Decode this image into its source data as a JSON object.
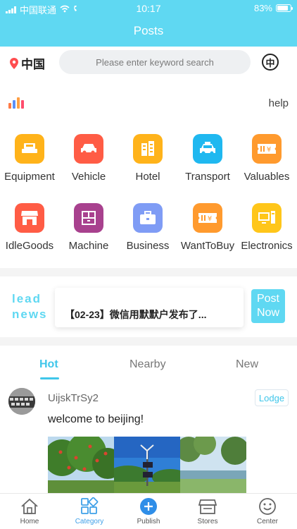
{
  "status_bar": {
    "carrier": "中国联通",
    "time": "10:17",
    "battery": "83%",
    "battery_level": 0.83
  },
  "header": {
    "title": "Posts"
  },
  "search": {
    "location": "中国",
    "placeholder": "Please enter keyword search",
    "lang_button": "中"
  },
  "toolbar": {
    "help_label": "help",
    "bar_colors": [
      "#ff7a45",
      "#5b8ff9",
      "#ff9f43",
      "#ff4d6d"
    ]
  },
  "categories": [
    {
      "label": "Equipment",
      "icon": "equipment-icon",
      "color": "#ffb31a"
    },
    {
      "label": "Vehicle",
      "icon": "car-icon",
      "color": "#ff5c45"
    },
    {
      "label": "Hotel",
      "icon": "hotel-icon",
      "color": "#ffb31a"
    },
    {
      "label": "Transport",
      "icon": "taxi-icon",
      "color": "#1fb8f0"
    },
    {
      "label": "Valuables",
      "icon": "ticket-icon",
      "color": "#ff9a2e"
    },
    {
      "label": "IdleGoods",
      "icon": "shop-icon",
      "color": "#ff5c45"
    },
    {
      "label": "Machine",
      "icon": "cabinet-icon",
      "color": "#a8418e"
    },
    {
      "label": "Business",
      "icon": "briefcase-icon",
      "color": "#7f9cf5"
    },
    {
      "label": "WantToBuy",
      "icon": "ticket-icon",
      "color": "#ff9a2e"
    },
    {
      "label": "Electronics",
      "icon": "computer-icon",
      "color": "#ffc61a"
    }
  ],
  "news": {
    "lead_label": "lead\nnews",
    "headline": "【02-23】微信用默默户发布了...",
    "post_button": "Post\nNow"
  },
  "tabs": [
    {
      "label": "Hot",
      "active": true
    },
    {
      "label": "Nearby",
      "active": false
    },
    {
      "label": "New",
      "active": false
    }
  ],
  "post": {
    "username": "UijskTrSy2",
    "badge": "Lodge",
    "text": "welcome to beijing!"
  },
  "bottom_nav": [
    {
      "label": "Home",
      "icon": "home-icon",
      "active": false
    },
    {
      "label": "Category",
      "icon": "category-icon",
      "active": true
    },
    {
      "label": "Publish",
      "icon": "plus-icon",
      "active": false
    },
    {
      "label": "Stores",
      "icon": "store-icon",
      "active": false
    },
    {
      "label": "Center",
      "icon": "smile-icon",
      "active": false
    }
  ],
  "colors": {
    "primary": "#5fd8f2",
    "accent": "#3fc6ea"
  }
}
